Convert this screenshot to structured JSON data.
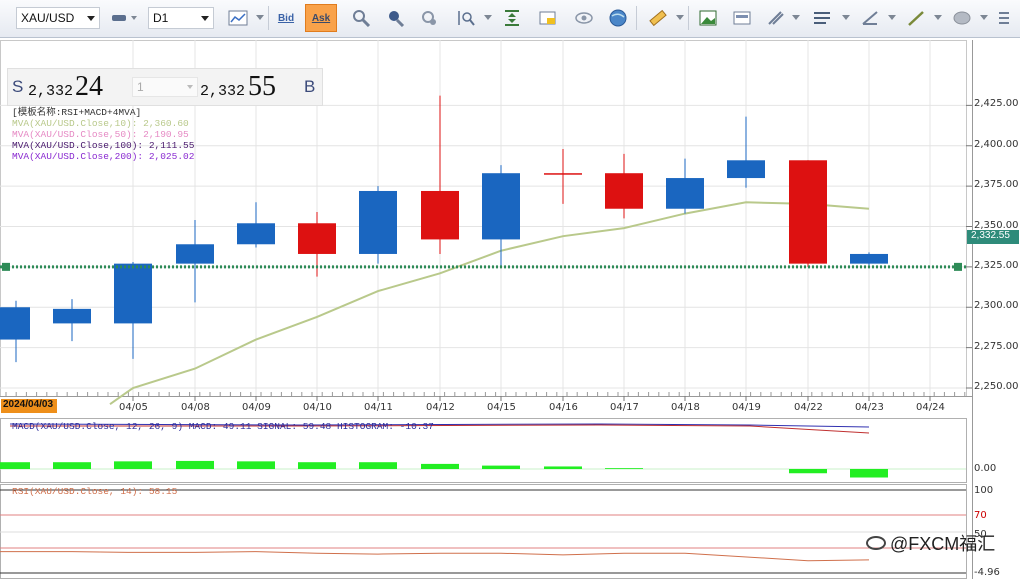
{
  "toolbar": {
    "symbol": "XAU/USD",
    "timeframe": "D1",
    "bid_label": "Bid",
    "ask_label": "Ask",
    "icons": [
      "chart-type-icon",
      "candle-icon",
      "line-study-icon",
      "zoom-in-icon",
      "zoom-out-icon",
      "auto-scroll-icon",
      "magnify-icon",
      "fit-icon",
      "template-icon",
      "hide-icon",
      "globe-icon",
      "ruler-icon",
      "image-icon",
      "screenshot-icon",
      "tools-icon",
      "lines-icon",
      "fibonacci-icon",
      "trendline-icon",
      "shape-icon",
      "more-icon"
    ]
  },
  "price_panel": {
    "sell_letter": "S",
    "sell_small": "2,332",
    "sell_big": "24",
    "lot": "1",
    "buy_small": "2,332",
    "buy_big": "55",
    "buy_letter": "B"
  },
  "legend": {
    "template": "[模板名称:RSI+MACD+4MVA]",
    "items": [
      {
        "text": "MVA(XAU/USD.Close,10): 2,360.60",
        "color": "#b9c98b"
      },
      {
        "text": "MVA(XAU/USD.Close,50): 2,190.95",
        "color": "#e68ac4"
      },
      {
        "text": "MVA(XAU/USD.Close,100): 2,111.55",
        "color": "#4a1a6e"
      },
      {
        "text": "MVA(XAU/USD.Close,200): 2,025.02",
        "color": "#8a2bd1"
      }
    ]
  },
  "date_badge": "2024/04/03",
  "price_badge": "2,332.55",
  "chart_data": {
    "type": "candlestick",
    "ylim": [
      2240,
      2440
    ],
    "y_ticks": [
      {
        "v": 2425,
        "label": "2,425.00"
      },
      {
        "v": 2400,
        "label": "2,400.00"
      },
      {
        "v": 2375,
        "label": "2,375.00"
      },
      {
        "v": 2350,
        "label": "2,350.00"
      },
      {
        "v": 2325,
        "label": "2,325.00"
      },
      {
        "v": 2300,
        "label": "2,300.00"
      },
      {
        "v": 2275,
        "label": "2,275.00"
      },
      {
        "v": 2250,
        "label": "2,250.00"
      }
    ],
    "x_labels": [
      "04/05",
      "04/08",
      "04/09",
      "04/10",
      "04/11",
      "04/12",
      "04/15",
      "04/16",
      "04/17",
      "04/18",
      "04/19",
      "04/22",
      "04/23",
      "04/24"
    ],
    "candles": [
      {
        "date": "04/03",
        "open": 2280,
        "close": 2300,
        "high": 2304,
        "low": 2266
      },
      {
        "date": "04/04",
        "open": 2290,
        "close": 2299,
        "high": 2305,
        "low": 2279
      },
      {
        "date": "04/05",
        "open": 2290,
        "close": 2327,
        "high": 2328,
        "low": 2268
      },
      {
        "date": "04/08",
        "open": 2327,
        "close": 2339,
        "high": 2354,
        "low": 2303
      },
      {
        "date": "04/09",
        "open": 2339,
        "close": 2352,
        "high": 2365,
        "low": 2337
      },
      {
        "date": "04/10",
        "open": 2352,
        "close": 2333,
        "high": 2359,
        "low": 2319
      },
      {
        "date": "04/11",
        "open": 2333,
        "close": 2372,
        "high": 2375,
        "low": 2327
      },
      {
        "date": "04/12",
        "open": 2372,
        "close": 2342,
        "high": 2431,
        "low": 2333
      },
      {
        "date": "04/15",
        "open": 2342,
        "close": 2383,
        "high": 2388,
        "low": 2325
      },
      {
        "date": "04/16",
        "open": 2383,
        "close": 2383,
        "high": 2398,
        "low": 2364
      },
      {
        "date": "04/17",
        "open": 2383,
        "close": 2361,
        "high": 2395,
        "low": 2355
      },
      {
        "date": "04/18",
        "open": 2361,
        "close": 2380,
        "high": 2392,
        "low": 2358
      },
      {
        "date": "04/19",
        "open": 2380,
        "close": 2391,
        "high": 2418,
        "low": 2374
      },
      {
        "date": "04/22",
        "open": 2391,
        "close": 2327,
        "high": 2391,
        "low": 2325
      },
      {
        "date": "04/23",
        "open": 2327,
        "close": 2333,
        "high": 2334,
        "low": 2326
      }
    ],
    "mva10": [
      2240,
      2250,
      2262,
      2280,
      2294,
      2310,
      2321,
      2335,
      2344,
      2349,
      2358,
      2365,
      2364,
      2361
    ],
    "bid_line": 2325,
    "macd_label": "MACD(XAU/USD.Close, 12, 26, 9)  MACD: 49.11  SIGNAL: 59.48  HISTOGRAM: -10.37",
    "macd_zero_label": "0.00",
    "macd_histogram": [
      8,
      8,
      9,
      9.5,
      9,
      8,
      8,
      6,
      4,
      3,
      1,
      0,
      -5,
      -10
    ],
    "rsi_label": "RSI(XAU/USD.Close, 14): 58.15",
    "rsi_ticks": [
      "100",
      "70",
      "50",
      "-4.96"
    ],
    "rsi_values": [
      74,
      74,
      73,
      73,
      74,
      72,
      71,
      72,
      72,
      70,
      72,
      72,
      63,
      64
    ]
  },
  "watermark": "@FXCM福汇",
  "colors": {
    "up": "#1a66c0",
    "down": "#dd1111",
    "ma10": "#b9c98b",
    "bid": "#2e8b57",
    "macd_hist": "#22ee22",
    "macd_line": "#3030b0",
    "signal_line": "#c03030",
    "rsi_line": "#d0704c"
  }
}
